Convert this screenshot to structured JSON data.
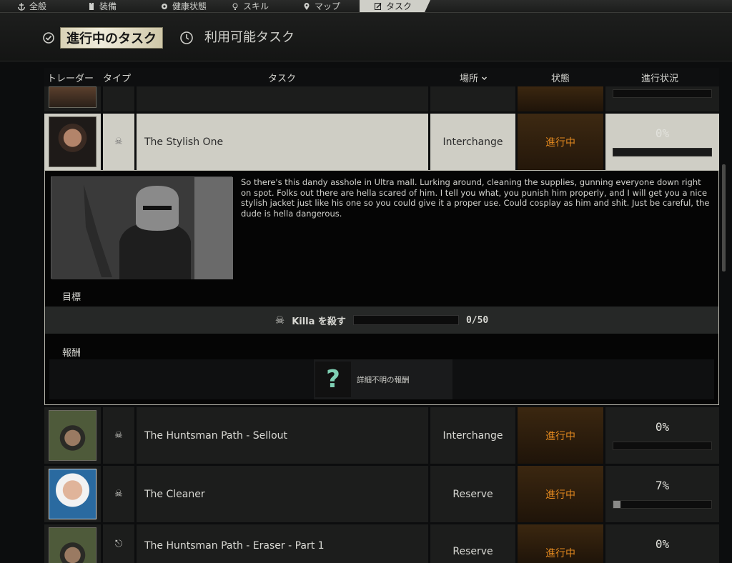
{
  "nav": {
    "general": "全般",
    "gear": "装備",
    "health": "健康状態",
    "skills": "スキル",
    "map": "マップ",
    "tasks": "タスク"
  },
  "tabs": {
    "active": "進行中のタスク",
    "available": "利用可能タスク"
  },
  "columns": {
    "trader": "トレーダー",
    "type": "タイプ",
    "task": "タスク",
    "location": "場所",
    "state": "状態",
    "progress": "進行状況"
  },
  "rows": [
    {
      "task": "The Stylish One",
      "location": "Interchange",
      "state": "進行中",
      "progress": "0%",
      "progress_value": 0
    },
    {
      "task": "The Huntsman Path - Sellout",
      "location": "Interchange",
      "state": "進行中",
      "progress": "0%",
      "progress_value": 0
    },
    {
      "task": "The Cleaner",
      "location": "Reserve",
      "state": "進行中",
      "progress": "7%",
      "progress_value": 7
    },
    {
      "task": "The Huntsman Path - Eraser - Part 1",
      "location": "Reserve",
      "state": "進行中",
      "progress": "0%",
      "progress_value": 0
    }
  ],
  "detail": {
    "description": "So there's this dandy asshole in Ultra mall. Lurking around, cleaning the supplies, gunning everyone down right on spot. Folks out there are hella scared of him. I tell you what, you punish him properly, and I will get you a nice stylish jacket just like his one so you could give it a proper use. Could cosplay as him and shit. Just be careful, the dude is hella dangerous.",
    "objectives_label": "目標",
    "objective_text": "Killa を殺す",
    "objective_count": "0/50",
    "objective_progress_value": 0,
    "rewards_label": "報酬",
    "reward_text": "詳細不明の報酬",
    "reward_symbol": "?"
  }
}
